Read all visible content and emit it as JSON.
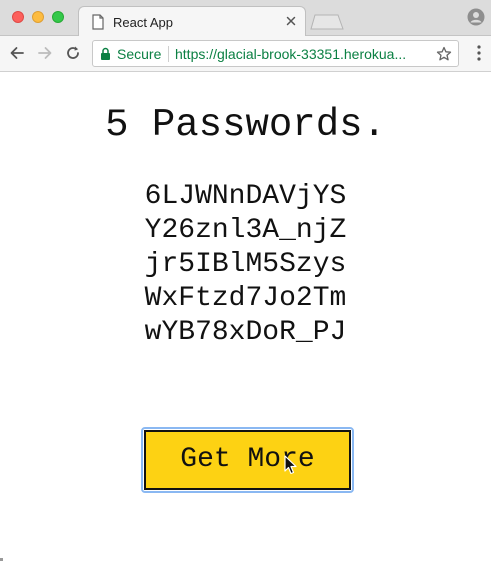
{
  "browser": {
    "tab": {
      "title": "React App",
      "favicon_icon": "document-icon",
      "close_icon": "close-icon"
    },
    "toolbar": {
      "back_icon": "arrow-left-icon",
      "forward_icon": "arrow-right-icon",
      "reload_icon": "reload-icon",
      "security_label": "Secure",
      "url": "https://glacial-brook-33351.herokua...",
      "bookmark_icon": "star-icon",
      "menu_icon": "kebab-menu-icon"
    },
    "colors": {
      "secure_green": "#0b8043",
      "tabstrip_bg": "#dcdcdc"
    }
  },
  "page": {
    "heading": "5 Passwords.",
    "passwords": [
      "6LJWNnDAVjYS",
      "Y26znl3A_njZ",
      "jr5IBlM5Szys",
      "WxFtzd7Jo2Tm",
      "wYB78xDoR_PJ"
    ],
    "button_label": "Get More",
    "colors": {
      "button_bg": "#fdd213",
      "button_border": "#111111",
      "focus_ring": "#8ab8f2"
    }
  }
}
